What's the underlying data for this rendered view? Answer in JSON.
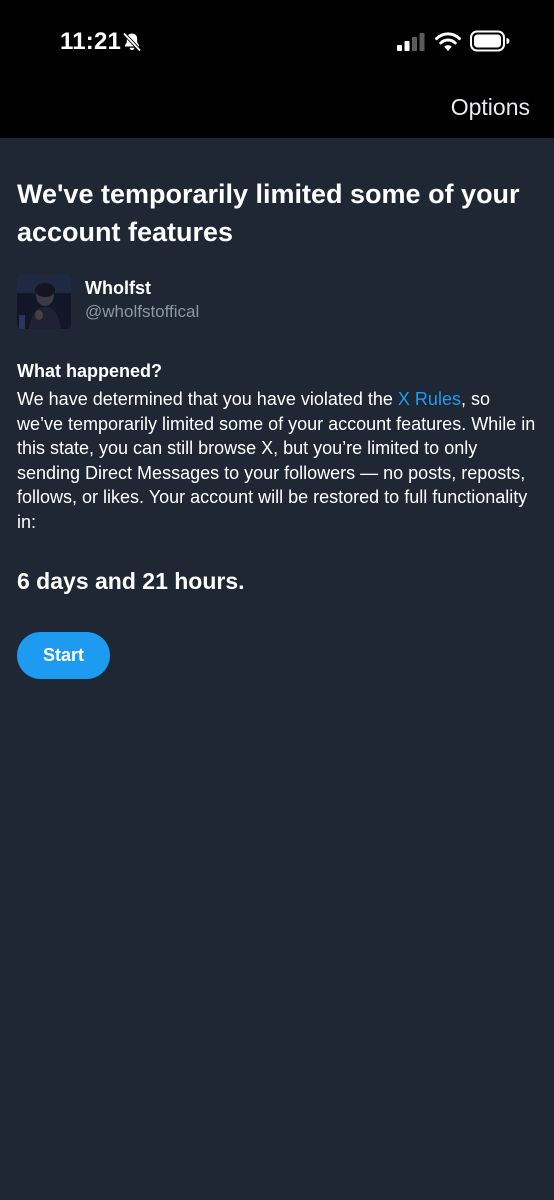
{
  "status_bar": {
    "time": "11:21",
    "icons": [
      "bell-slash-icon",
      "signal-icon",
      "wifi-icon",
      "battery-icon"
    ]
  },
  "header": {
    "options_label": "Options"
  },
  "page": {
    "title": "We've temporarily limited some of your account features"
  },
  "profile": {
    "display_name": "Wholfst",
    "handle": "@wholfstoffical"
  },
  "what_happened": {
    "heading": "What happened?",
    "text_before_link": "We have determined that you have violated the ",
    "link_text": "X Rules",
    "text_after_link": ", so we’ve temporarily limited some of your account features. While in this state, you can still browse X, but you’re limited to only sending Direct Messages to your followers — no posts, reposts, follows, or likes. Your account will be restored to full functionality in:"
  },
  "countdown": "6 days and 21 hours.",
  "start_button_label": "Start",
  "colors": {
    "background": "#1e2733",
    "top_bar": "#000000",
    "accent": "#1d9bf0",
    "secondary_text": "#8b98a5"
  }
}
